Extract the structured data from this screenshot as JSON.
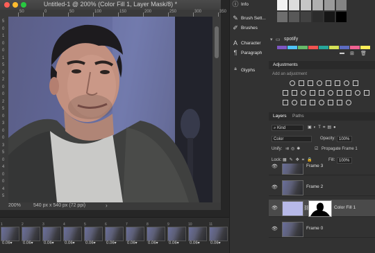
{
  "document": {
    "title": "Untitled-1 @ 200% (Color Fill 1, Layer Mask/8) *",
    "zoom": "200%",
    "dimensions": "540 px x 540 px (72 ppi)",
    "ruler_top": [
      "50",
      "0",
      "50",
      "100",
      "150",
      "200",
      "250",
      "300",
      "350"
    ],
    "ruler_left": [
      "5",
      "0",
      "1",
      "0",
      "0",
      "1",
      "5",
      "0",
      "2",
      "0",
      "0",
      "2",
      "5",
      "0",
      "3",
      "0",
      "0",
      "3",
      "5",
      "0",
      "4",
      "0",
      "0",
      "4",
      "5"
    ]
  },
  "timeline": {
    "frames": [
      {
        "num": "1",
        "delay": "0.06▾"
      },
      {
        "num": "2",
        "delay": "0.06▾"
      },
      {
        "num": "3",
        "delay": "0.06▾"
      },
      {
        "num": "4",
        "delay": "0.06▾"
      },
      {
        "num": "5",
        "delay": "0.06▾"
      },
      {
        "num": "6",
        "delay": "0.06▾"
      },
      {
        "num": "7",
        "delay": "0.06▾"
      },
      {
        "num": "8",
        "delay": "0.06▾"
      },
      {
        "num": "9",
        "delay": "0.06▾"
      },
      {
        "num": "10",
        "delay": "0.06▾"
      },
      {
        "num": "11",
        "delay": "0.06▾"
      }
    ]
  },
  "mid_panel": {
    "items": [
      {
        "label": "Info",
        "icon": "info-icon",
        "glyph": "ⓘ"
      },
      {
        "label": "Brush Sett...",
        "icon": "brush-settings-icon",
        "glyph": "✎"
      },
      {
        "label": "Brushes",
        "icon": "brushes-icon",
        "glyph": "✐"
      },
      {
        "label": "Character",
        "icon": "character-icon",
        "glyph": "A"
      },
      {
        "label": "Paragraph",
        "icon": "paragraph-icon",
        "glyph": "¶"
      },
      {
        "label": "Glyphs",
        "icon": "glyphs-icon",
        "glyph": "ª"
      }
    ]
  },
  "swatches": {
    "folder_name": "spotify",
    "grays": [
      "#f2f2f2",
      "#dcdcdc",
      "#c6c6c6",
      "#b0b0b0",
      "#9a9a9a",
      "#848484",
      "#6e6e6e",
      "#585858",
      "#424242",
      "#2c2c2c",
      "#161616",
      "#000000"
    ],
    "spotify_colors": [
      "#7e57c2",
      "#4fc3f7",
      "#66bb6a",
      "#ef5350",
      "#26a69a",
      "#d4e157",
      "#5c6bc0",
      "#f06292",
      "#ffee58"
    ]
  },
  "adjustments": {
    "title": "Adjustments",
    "subtitle": "Add an adjustment"
  },
  "layers": {
    "tab_layers": "Layers",
    "tab_paths": "Paths",
    "kind_label": "Kind",
    "blend_mode": "Color",
    "opacity_label": "Opacity:",
    "opacity_value": "100%",
    "unify_label": "Unify:",
    "propagate_label": "Propagate Frame 1",
    "lock_label": "Lock:",
    "fill_label": "Fill:",
    "fill_value": "100%",
    "rows": [
      {
        "name": "Frame 3"
      },
      {
        "name": "Frame 2"
      },
      {
        "name": "Color Fill 1"
      },
      {
        "name": "Frame 0"
      }
    ]
  }
}
